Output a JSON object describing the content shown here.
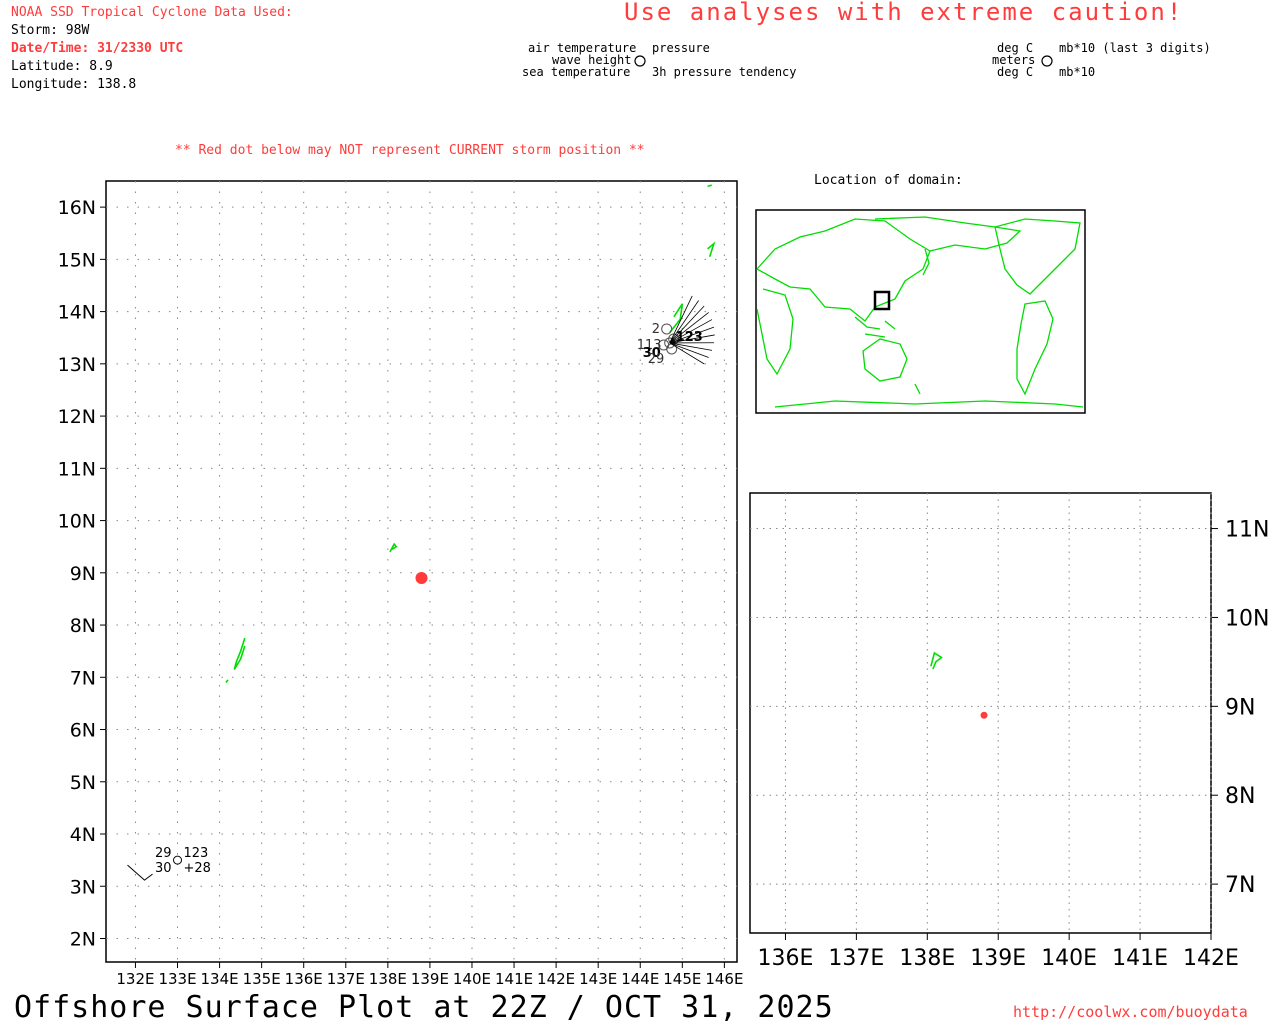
{
  "header": {
    "source": "NOAA SSD Tropical Cyclone Data Used:",
    "storm": "Storm: 98W",
    "datetime": "Date/Time: 31/2330 UTC",
    "latitude": "Latitude: 8.9",
    "longitude": "Longitude: 138.8"
  },
  "caution": "Use analyses with extreme caution!",
  "legend_left": {
    "air_temp": "air temperature",
    "wave_height": "wave height",
    "sea_temp": "sea temperature",
    "pressure": "pressure",
    "pressure_tendency": "3h pressure tendency"
  },
  "legend_right": {
    "deg_c_1": "deg C",
    "meters": "meters",
    "deg_c_2": "deg C",
    "mb_last3": "mb*10 (last 3 digits)",
    "mb": "mb*10"
  },
  "warning": "** Red dot below may NOT represent CURRENT storm position **",
  "location_title": "Location of domain:",
  "footer": "Offshore Surface Plot at 22Z / OCT 31, 2025",
  "url": "http://coolwx.com/buoydata",
  "colors": {
    "land": "#00dd00",
    "storm": "#ff3b3b",
    "grid": "#888888"
  },
  "main_map": {
    "lat_ticks": [
      "2N",
      "3N",
      "4N",
      "5N",
      "6N",
      "7N",
      "8N",
      "9N",
      "10N",
      "11N",
      "12N",
      "13N",
      "14N",
      "15N",
      "16N"
    ],
    "lon_ticks": [
      "132E",
      "133E",
      "134E",
      "135E",
      "136E",
      "137E",
      "138E",
      "139E",
      "140E",
      "141E",
      "142E",
      "143E",
      "144E",
      "145E",
      "146E"
    ],
    "storm": {
      "lat": 8.9,
      "lon": 138.8
    },
    "station_sw": {
      "air_temp": "29",
      "sea_temp": "30",
      "pressure": "123",
      "tendency": "+28"
    },
    "station_cluster": {
      "labels": [
        "2",
        "123",
        "113",
        "30",
        "29"
      ]
    }
  },
  "inset_map": {
    "lat_ticks": [
      "7N",
      "8N",
      "9N",
      "10N",
      "11N"
    ],
    "lon_ticks": [
      "136E",
      "137E",
      "138E",
      "139E",
      "140E",
      "141E",
      "142E"
    ],
    "storm": {
      "lat": 8.9,
      "lon": 138.8
    }
  }
}
